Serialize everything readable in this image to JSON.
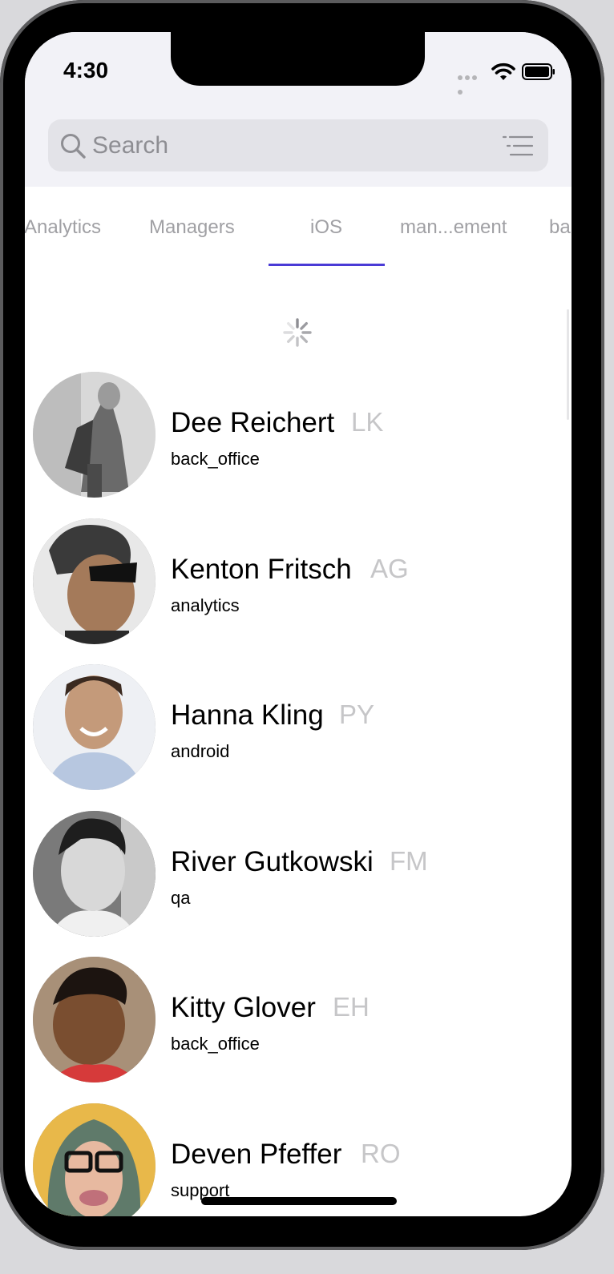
{
  "status_bar": {
    "time": "4:30"
  },
  "search": {
    "placeholder": "Search"
  },
  "tabs": [
    {
      "label": "Analytics",
      "selected": false
    },
    {
      "label": "Managers",
      "selected": false
    },
    {
      "label": "iOS",
      "selected": true
    },
    {
      "label": "man...ement",
      "selected": false
    },
    {
      "label": "ba",
      "selected": false
    }
  ],
  "colors": {
    "accent": "#4a3bd6",
    "header_background": "#f2f2f7",
    "search_field": "#e3e3e8",
    "secondary_text": "#c6c6c8",
    "tab_text": "#a0a0a4"
  },
  "users": [
    {
      "name": "Dee Reichert",
      "code": "LK",
      "department": "back_office"
    },
    {
      "name": "Kenton Fritsch",
      "code": "AG",
      "department": "analytics"
    },
    {
      "name": "Hanna Kling",
      "code": "PY",
      "department": "android"
    },
    {
      "name": "River Gutkowski",
      "code": "FM",
      "department": "qa"
    },
    {
      "name": "Kitty Glover",
      "code": "EH",
      "department": "back_office"
    },
    {
      "name": "Deven Pfeffer",
      "code": "RO",
      "department": "support"
    }
  ]
}
